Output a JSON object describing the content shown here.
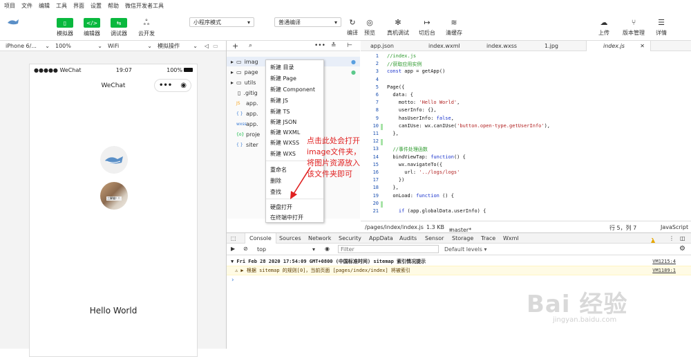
{
  "menu": [
    "项目",
    "文件",
    "编辑",
    "工具",
    "界面",
    "设置",
    "帮助",
    "微信开发者工具"
  ],
  "toolbar": {
    "simulator": "模拟器",
    "editor": "编辑器",
    "debugger": "调试器",
    "cloud": "云开发",
    "mode": "小程序模式",
    "compile_mode": "普通编译",
    "compile": "编译",
    "preview": "预览",
    "real_debug": "真机调试",
    "backend": "切后台",
    "clear_cache": "清缓存",
    "upload": "上传",
    "version": "版本管理",
    "details": "详情"
  },
  "devbar": {
    "device": "iPhone 6/...",
    "zoom": "100%",
    "network": "WiFi",
    "ops": "模拟操作"
  },
  "phone": {
    "carrier": "●●●●● WeChat",
    "time": "19:07",
    "battery": "100%",
    "title": "WeChat",
    "hello": "Hello World",
    "cat_label": "三脚猫！！"
  },
  "filetree": [
    "imag",
    "page",
    "utils",
    ".gitig",
    "app.",
    "app.",
    "app.",
    "proje",
    "siter"
  ],
  "filetree_ext": [
    "",
    "",
    "",
    "",
    "JS",
    "{ }",
    "wxss",
    "{o}",
    "{ }"
  ],
  "context_menu": [
    "新建 目录",
    "新建 Page",
    "新建 Component",
    "新建 JS",
    "新建 TS",
    "新建 JSON",
    "新建 WXML",
    "新建 WXSS",
    "新建 WXS",
    "重命名",
    "删除",
    "查找",
    "硬盘打开",
    "在终端中打开"
  ],
  "annotation": [
    "点击此处会打开",
    "image文件夹，",
    "将图片资源放入",
    "该文件夹即可"
  ],
  "tabs": [
    "app.json",
    "index.wxml",
    "index.wxss",
    "1.jpg",
    "index.js"
  ],
  "code_lines": [
    {
      "n": "1",
      "t": "//index.js",
      "c": "cm"
    },
    {
      "n": "2",
      "t": "//获取应用实例",
      "c": "cm"
    },
    {
      "n": "3",
      "t": "const app = getApp()",
      "c": ""
    },
    {
      "n": "4",
      "t": "",
      "c": ""
    },
    {
      "n": "5",
      "t": "Page({",
      "c": ""
    },
    {
      "n": "6",
      "t": "  data: {",
      "c": ""
    },
    {
      "n": "7",
      "t": "    motto: 'Hello World',",
      "c": ""
    },
    {
      "n": "8",
      "t": "    userInfo: {},",
      "c": ""
    },
    {
      "n": "9",
      "t": "    hasUserInfo: false,",
      "c": ""
    },
    {
      "n": "10",
      "t": "    canIUse: wx.canIUse('button.open-type.getUserInfo'),",
      "c": ""
    },
    {
      "n": "11",
      "t": "  },",
      "c": ""
    },
    {
      "n": "12",
      "t": "",
      "c": ""
    },
    {
      "n": "13",
      "t": "  //事件处理函数",
      "c": "cm"
    },
    {
      "n": "14",
      "t": "  bindViewTap: function() {",
      "c": ""
    },
    {
      "n": "15",
      "t": "    wx.navigateTo({",
      "c": ""
    },
    {
      "n": "16",
      "t": "      url: '../logs/logs'",
      "c": ""
    },
    {
      "n": "17",
      "t": "    })",
      "c": ""
    },
    {
      "n": "18",
      "t": "  },",
      "c": ""
    },
    {
      "n": "19",
      "t": "  onLoad: function () {",
      "c": ""
    },
    {
      "n": "20",
      "t": "",
      "c": ""
    },
    {
      "n": "21",
      "t": "    if (app.globalData.userInfo) {",
      "c": ""
    }
  ],
  "editor_status": {
    "path": "/pages/index/index.js",
    "size": "1.3 KB",
    "branch": "master*",
    "pos": "行 5，列 7",
    "lang": "JavaScript"
  },
  "devtools_tabs": [
    "Console",
    "Sources",
    "Network",
    "Security",
    "AppData",
    "Audits",
    "Sensor",
    "Storage",
    "Trace",
    "Wxml"
  ],
  "warn_count": "1",
  "filter": {
    "context": "top",
    "placeholder": "Filter",
    "levels": "Default levels ▾"
  },
  "console": {
    "line1": "▼ Fri Feb 28 2020 17:54:09 GMT+0800 (中国标准时间) sitemap 索引情况提示",
    "src1": "VM1215:4",
    "line2": "⚠ ▶ 根据 sitemap 的规则[0]，当前页面 [pages/index/index] 将被索引",
    "src2": "VM1189:1",
    "prompt": "›"
  },
  "watermark": {
    "main": "Bai 经验",
    "sub": "jingyan.baidu.com"
  }
}
